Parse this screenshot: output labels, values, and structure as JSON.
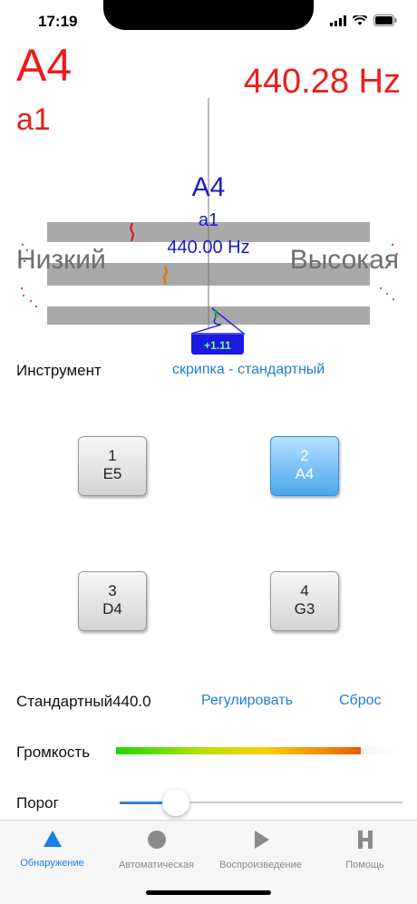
{
  "status": {
    "time": "17:19"
  },
  "detected": {
    "note": "A4",
    "octave": "a1",
    "frequency": "440.28 Hz"
  },
  "target": {
    "note": "A4",
    "octave": "a1",
    "frequency": "440.00 Hz"
  },
  "gauge": {
    "low_label": "Низкий",
    "high_label": "Высокая",
    "cents": "+1.11"
  },
  "instrument": {
    "label": "Инструмент",
    "value": "скрипка - стандартный"
  },
  "strings": [
    {
      "number": "1",
      "note": "E5",
      "active": false
    },
    {
      "number": "2",
      "note": "A4",
      "active": true
    },
    {
      "number": "3",
      "note": "D4",
      "active": false
    },
    {
      "number": "4",
      "note": "G3",
      "active": false
    }
  ],
  "standard": {
    "label": "Стандартный",
    "value": "440.0",
    "adjust": "Регулировать",
    "reset": "Сброс"
  },
  "volume": {
    "label": "Громкость",
    "level": 0.86
  },
  "threshold": {
    "label": "Порог",
    "level": 0.2
  },
  "tabs": [
    {
      "label": "Обнаружение",
      "icon": "triangle-icon",
      "active": true
    },
    {
      "label": "Автоматическая",
      "icon": "circle-icon",
      "active": false
    },
    {
      "label": "Воспроизведение",
      "icon": "play-icon",
      "active": false
    },
    {
      "label": "Помощь",
      "icon": "help-h-icon",
      "active": false
    }
  ],
  "colors": {
    "accent": "#1a7fe6",
    "detected": "#ee1c1c",
    "target": "#1a1acc",
    "gauge_band": "#a9a9a9"
  }
}
